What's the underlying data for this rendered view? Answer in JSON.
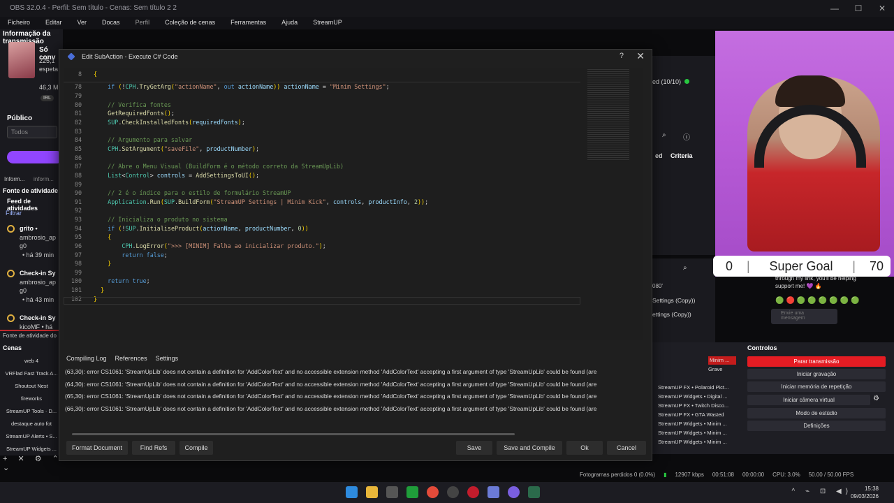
{
  "obs": {
    "title": "OBS 32.0.4 - Perfil: Sem título - Cenas: Sem título 2 2",
    "menu": [
      "Ficheiro",
      "Editar",
      "Ver",
      "Docas",
      "Perfil",
      "Coleção de cenas",
      "Ferramentas",
      "Ajuda",
      "StreamUP"
    ]
  },
  "left_dock": {
    "info_title": "Informação da transmissão",
    "stream_name": "Só conv",
    "viewers": "225,1",
    "subtitle": "espeta",
    "value": "46,3 M",
    "badge": "IRL",
    "public_label": "Público",
    "public_select": "Todos",
    "tab_a": "Inform...",
    "tab_b": "inform...",
    "activity_title": "Fonte de atividade",
    "feed_title": "Feed de atividades",
    "filter": "Filtrar",
    "events": [
      {
        "title": "grito •",
        "user": "ambrosio_ap",
        "user2": "g0",
        "time": "• há 39 min"
      },
      {
        "title": "Check-in Sy",
        "user": "ambrosio_ap",
        "user2": "g0",
        "time": "• há 43 min"
      },
      {
        "title": "Check-in Sy",
        "user": "kicoMF • há",
        "user2": "",
        "time": ""
      }
    ],
    "activity_footer": "Fonte de atividade do",
    "scenes_title": "Cenas",
    "scenes": [
      "web 4",
      "VRFlad Fast Track A...",
      "Shoutout Nest",
      "fireworks",
      "StreamUP Tools · D...",
      "destaque auto fot",
      "StreamUP Alerts • S...",
      "StreamUP Widgets ..."
    ]
  },
  "dialog": {
    "title": "Edit SubAction - Execute C# Code",
    "help": "?",
    "close": "✕",
    "tabs": [
      "Compiling Log",
      "References",
      "Settings"
    ],
    "log": [
      "(63,30): error CS1061: 'StreamUpLib' does not contain a definition for 'AddColorText' and no accessible extension method 'AddColorText' accepting a first argument of type 'StreamUpLib' could be found (are",
      "(64,30): error CS1061: 'StreamUpLib' does not contain a definition for 'AddColorText' and no accessible extension method 'AddColorText' accepting a first argument of type 'StreamUpLib' could be found (are",
      "(65,30): error CS1061: 'StreamUpLib' does not contain a definition for 'AddColorText' and no accessible extension method 'AddColorText' accepting a first argument of type 'StreamUpLib' could be found (are",
      "(66,30): error CS1061: 'StreamUpLib' does not contain a definition for 'AddColorText' and no accessible extension method 'AddColorText' accepting a first argument of type 'StreamUpLib' could be found (are"
    ],
    "buttons": {
      "format": "Format Document",
      "find_refs": "Find Refs",
      "compile": "Compile",
      "save": "Save",
      "save_compile": "Save and Compile",
      "ok": "Ok",
      "cancel": "Cancel"
    }
  },
  "code": [
    {
      "n": "8",
      "t": "{"
    },
    {
      "n": "78",
      "t": "    if (!CPH.TryGetArg(\"actionName\", out actionName)) actionName = \"Minim Settings\";"
    },
    {
      "n": "79",
      "t": ""
    },
    {
      "n": "80",
      "t": "    // Verifica fontes"
    },
    {
      "n": "81",
      "t": "    GetRequiredFonts();"
    },
    {
      "n": "82",
      "t": "    SUP.CheckInstalledFonts(requiredFonts);"
    },
    {
      "n": "83",
      "t": ""
    },
    {
      "n": "84",
      "t": "    // Argumento para salvar"
    },
    {
      "n": "85",
      "t": "    CPH.SetArgument(\"saveFile\", productNumber);"
    },
    {
      "n": "86",
      "t": ""
    },
    {
      "n": "87",
      "t": "    // Abre o Menu Visual (BuildForm é o método correto da StreamUpLib)"
    },
    {
      "n": "88",
      "t": "    List<Control> controls = AddSettingsToUI();"
    },
    {
      "n": "89",
      "t": ""
    },
    {
      "n": "90",
      "t": "    // 2 é o índice para o estilo de formulário StreamUP"
    },
    {
      "n": "91",
      "t": "    Application.Run(SUP.BuildForm(\"StreamUP Settings | Minim Kick\", controls, productInfo, 2));"
    },
    {
      "n": "92",
      "t": ""
    },
    {
      "n": "93",
      "t": "    // Inicializa o produto no sistema"
    },
    {
      "n": "94",
      "t": "    if (!SUP.InitialiseProduct(actionName, productNumber, 0))"
    },
    {
      "n": "95",
      "t": "    {"
    },
    {
      "n": "96",
      "t": "        CPH.LogError(\">>> [MINIM] Falha ao inicializar produto.\");"
    },
    {
      "n": "97",
      "t": "        return false;"
    },
    {
      "n": "98",
      "t": "    }"
    },
    {
      "n": "99",
      "t": ""
    },
    {
      "n": "100",
      "t": "    return true;"
    },
    {
      "n": "101",
      "t": "  }"
    },
    {
      "n": "102",
      "t": "}"
    }
  ],
  "right": {
    "sources_count": "ed (10/10)",
    "criteria": "Criteria",
    "ed": "ed",
    "goal_left": "0",
    "goal_title": "Super Goal",
    "goal_right": "70",
    "chat_text": "through my link, you'll be helping support me! 💜 🔥",
    "chat_placeholder": "Envie uma mensagem",
    "res": "080'",
    "settings_copy_1": "Settings (Copy))",
    "settings_copy_2": "ettings (Copy))",
    "source_list": [
      "Minim ...",
      "Grave",
      "StreamUP FX • Polaroid Pict...",
      "StreamUP Widgets • Digital ...",
      "StreamUP FX • Twitch Disco...",
      "StreamUP FX • GTA Wasted",
      "StreamUP Widgets • Minim ...",
      "StreamUP Widgets • Minim ...",
      "StreamUP Widgets • Minim ..."
    ],
    "controls_title": "Controlos",
    "controls": [
      "Parar transmissão",
      "Iniciar gravação",
      "Iniciar memória de repetição",
      "Iniciar câmera virtual",
      "Modo de estúdio",
      "Definições"
    ],
    "status": {
      "dropped": "Fotogramas perdidos 0 (0.0%)",
      "kbps": "12907 kbps",
      "time1": "00:51:08",
      "time2": "00:00:00",
      "cpu": "CPU: 3.0%",
      "fps": "50.00 / 50.00 FPS"
    }
  },
  "taskbar": {
    "time": "15:38",
    "date": "09/03/2026"
  },
  "colors": {
    "accent_red": "#e51c23",
    "purple": "#9146ff",
    "obs_bg": "#1a1a1f"
  }
}
